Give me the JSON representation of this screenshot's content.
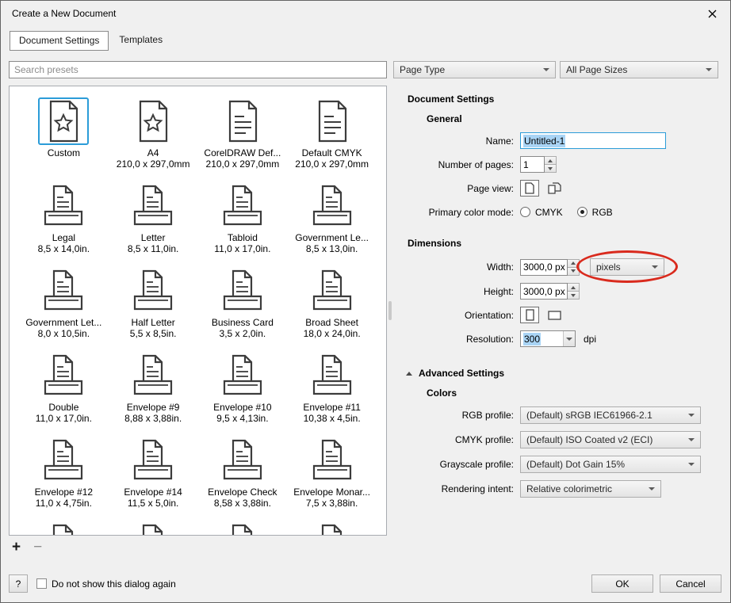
{
  "dialog": {
    "title": "Create a New Document",
    "tabs": [
      {
        "label": "Document Settings",
        "active": true
      },
      {
        "label": "Templates",
        "active": false
      }
    ],
    "search_placeholder": "Search presets",
    "page_type_filter": "Page Type",
    "page_size_filter": "All Page Sizes"
  },
  "presets": [
    {
      "name": "Custom",
      "size": "",
      "icon": "star",
      "selected": true
    },
    {
      "name": "A4",
      "size": "210,0 x 297,0mm",
      "icon": "star",
      "selected": false
    },
    {
      "name": "CorelDRAW Def...",
      "size": "210,0 x 297,0mm",
      "icon": "lines",
      "selected": false
    },
    {
      "name": "Default CMYK",
      "size": "210,0 x 297,0mm",
      "icon": "lines",
      "selected": false
    },
    {
      "name": "Legal",
      "size": "8,5 x 14,0in.",
      "icon": "tray",
      "selected": false
    },
    {
      "name": "Letter",
      "size": "8,5 x 11,0in.",
      "icon": "tray",
      "selected": false
    },
    {
      "name": "Tabloid",
      "size": "11,0 x 17,0in.",
      "icon": "tray",
      "selected": false
    },
    {
      "name": "Government Le...",
      "size": "8,5 x 13,0in.",
      "icon": "tray",
      "selected": false
    },
    {
      "name": "Government Let...",
      "size": "8,0 x 10,5in.",
      "icon": "tray",
      "selected": false
    },
    {
      "name": "Half Letter",
      "size": "5,5 x 8,5in.",
      "icon": "tray",
      "selected": false
    },
    {
      "name": "Business Card",
      "size": "3,5 x 2,0in.",
      "icon": "tray",
      "selected": false
    },
    {
      "name": "Broad Sheet",
      "size": "18,0 x 24,0in.",
      "icon": "tray",
      "selected": false
    },
    {
      "name": "Double",
      "size": "11,0 x 17,0in.",
      "icon": "tray",
      "selected": false
    },
    {
      "name": "Envelope #9",
      "size": "8,88 x 3,88in.",
      "icon": "tray",
      "selected": false
    },
    {
      "name": "Envelope #10",
      "size": "9,5 x 4,13in.",
      "icon": "tray",
      "selected": false
    },
    {
      "name": "Envelope #11",
      "size": "10,38 x 4,5in.",
      "icon": "tray",
      "selected": false
    },
    {
      "name": "Envelope #12",
      "size": "11,0 x 4,75in.",
      "icon": "tray",
      "selected": false
    },
    {
      "name": "Envelope #14",
      "size": "11,5 x 5,0in.",
      "icon": "tray",
      "selected": false
    },
    {
      "name": "Envelope Check",
      "size": "8,58 x 3,88in.",
      "icon": "tray",
      "selected": false
    },
    {
      "name": "Envelope Monar...",
      "size": "7,5 x 3,88in.",
      "icon": "tray",
      "selected": false
    },
    {
      "name": "",
      "size": "",
      "icon": "tray",
      "selected": false
    },
    {
      "name": "",
      "size": "",
      "icon": "tray",
      "selected": false
    },
    {
      "name": "",
      "size": "",
      "icon": "tray",
      "selected": false
    },
    {
      "name": "",
      "size": "",
      "icon": "tray",
      "selected": false
    }
  ],
  "preset_actions": {
    "add_label": "+",
    "remove_label": "−"
  },
  "settings": {
    "heading": "Document Settings",
    "general": {
      "heading": "General",
      "name_label": "Name:",
      "name_value": "Untitled-1",
      "pages_label": "Number of pages:",
      "pages_value": "1",
      "page_view_label": "Page view:",
      "color_mode_label": "Primary color mode:",
      "cmyk_label": "CMYK",
      "rgb_label": "RGB",
      "color_mode_selected": "RGB"
    },
    "dimensions": {
      "heading": "Dimensions",
      "width_label": "Width:",
      "width_value": "3000,0 px",
      "units_value": "pixels",
      "height_label": "Height:",
      "height_value": "3000,0 px",
      "orientation_label": "Orientation:",
      "resolution_label": "Resolution:",
      "resolution_value": "300",
      "dpi_label": "dpi"
    },
    "advanced": {
      "heading": "Advanced Settings",
      "colors_heading": "Colors",
      "rgb_profile_label": "RGB profile:",
      "rgb_profile_value": "(Default) sRGB IEC61966-2.1",
      "cmyk_profile_label": "CMYK profile:",
      "cmyk_profile_value": "(Default) ISO Coated v2 (ECI)",
      "gray_profile_label": "Grayscale profile:",
      "gray_profile_value": "(Default) Dot Gain 15%",
      "intent_label": "Rendering intent:",
      "intent_value": "Relative colorimetric"
    }
  },
  "annotation": {
    "shape": "ellipse",
    "color": "#d92a1d",
    "highlights": "pixels units dropdown"
  },
  "footer": {
    "help_label": "?",
    "checkbox_label": "Do not show this dialog again",
    "checkbox_checked": false,
    "ok_label": "OK",
    "cancel_label": "Cancel"
  }
}
